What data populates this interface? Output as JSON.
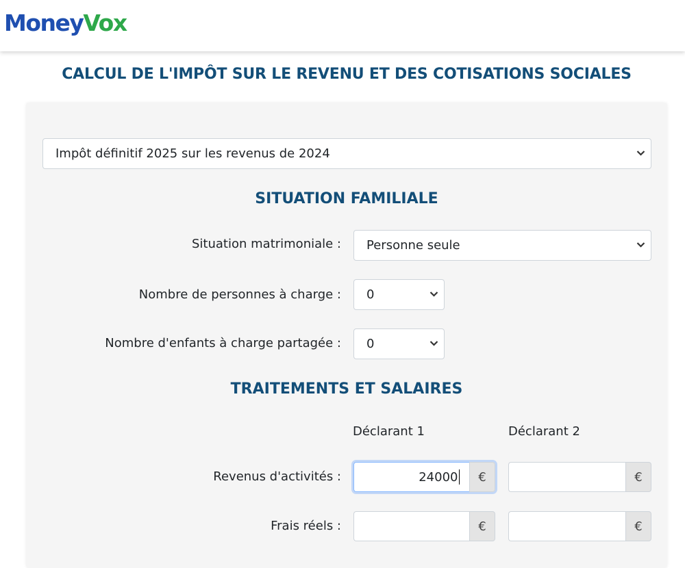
{
  "header": {
    "logo_part1": "Money",
    "logo_part2": "Vox"
  },
  "page_title": "CALCUL DE L'IMPÔT SUR LE REVENU ET DES COTISATIONS SOCIALES",
  "tax_year_select": {
    "value": "Impôt définitif 2025 sur les revenus de 2024"
  },
  "situation": {
    "title": "SITUATION FAMILIALE",
    "marital_label": "Situation matrimoniale :",
    "marital_value": "Personne seule",
    "dependents_label": "Nombre de personnes à charge :",
    "dependents_value": "0",
    "shared_children_label": "Nombre d'enfants à charge partagée :",
    "shared_children_value": "0"
  },
  "salaries": {
    "title": "TRAITEMENTS ET SALAIRES",
    "declarant1": "Déclarant 1",
    "declarant2": "Déclarant 2",
    "activity_label": "Revenus d'activités :",
    "activity_d1": "24000",
    "activity_d2": "",
    "expenses_label": "Frais réels :",
    "expenses_d1": "",
    "expenses_d2": "",
    "currency": "€"
  },
  "icons": {
    "chevron": "chevron-down-icon"
  }
}
